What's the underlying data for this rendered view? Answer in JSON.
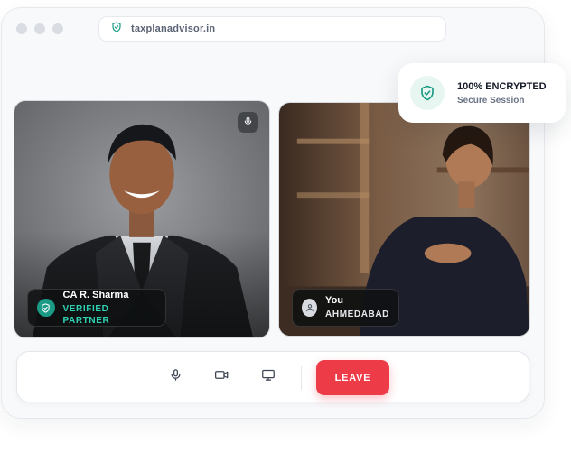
{
  "browser": {
    "url": "taxplanadvisor.in"
  },
  "participants": [
    {
      "name": "CA R. Sharma",
      "subtitle": "VERIFIED PARTNER",
      "subtitle_color": "#2fd3b3",
      "icon": "shield-check-icon",
      "mic_icon": "microphone-icon"
    },
    {
      "name": "You",
      "subtitle": "AHMEDABAD",
      "subtitle_color": "#e6e8ec",
      "icon": "user-icon"
    }
  ],
  "security_badge": {
    "title": "100% ENCRYPTED",
    "subtitle": "Secure Session",
    "icon": "shield-check-icon",
    "accent": "#1b9b86"
  },
  "controls": {
    "mic_icon": "microphone-icon",
    "camera_icon": "video-camera-icon",
    "screen_icon": "monitor-icon",
    "leave_label": "LEAVE",
    "leave_color": "#ee3b48"
  }
}
